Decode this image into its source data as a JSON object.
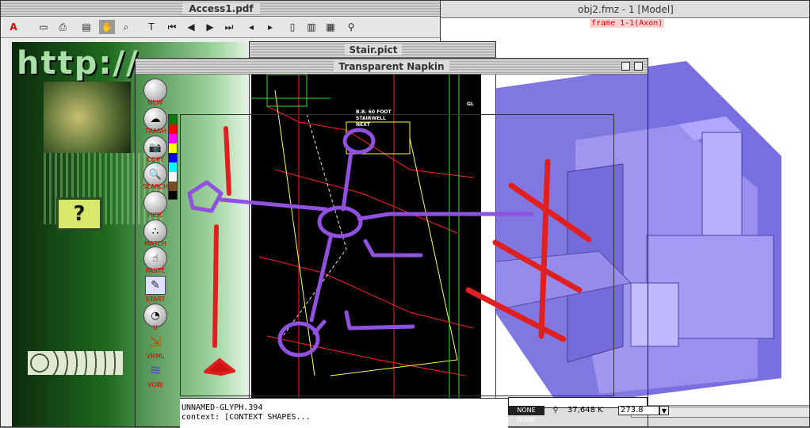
{
  "windows": {
    "pdf": {
      "title": "Access1.pdf",
      "banner": "http://"
    },
    "model": {
      "title": "obj2.fmz - 1 [Model]",
      "frame_label": "frame 1-1(Axon)"
    },
    "stair": {
      "title": "Stair.pict"
    },
    "napkin": {
      "title": "Transparent Napkin"
    }
  },
  "pdf_toolbar": {
    "icons": [
      "acrobat-icon",
      "open-icon",
      "print-icon",
      "page-icon",
      "hand-icon",
      "zoom-icon",
      "text-select-icon",
      "first-page-icon",
      "prev-page-icon",
      "next-page-icon",
      "last-page-icon",
      "go-back-icon",
      "go-forward-icon",
      "single-page-icon",
      "continuous-icon",
      "facing-icon",
      "find-icon"
    ]
  },
  "napkin_tools": [
    {
      "label": "NEW",
      "icon": "new-icon"
    },
    {
      "label": "TRASH",
      "icon": "trash-icon"
    },
    {
      "label": "COPY",
      "icon": "camera-icon"
    },
    {
      "label": "SEARCH",
      "icon": "search-icon"
    },
    {
      "label": "HIDE",
      "icon": "hide-icon"
    },
    {
      "label": "MATCH",
      "icon": "match-icon"
    },
    {
      "label": "PASTE",
      "icon": "paste-icon"
    },
    {
      "label": "START",
      "icon": "start-icon"
    },
    {
      "label": "U",
      "icon": "u-icon"
    },
    {
      "label": "VRML",
      "icon": "vrml-icon"
    },
    {
      "label": "VOBJ",
      "icon": "vobj-icon"
    }
  ],
  "palette": {
    "colors": [
      "#0a7a0a",
      "#ff0000",
      "#ff00ff",
      "#ffff00",
      "#0000ff",
      "#00ffff",
      "#ffffff",
      "#7a4a20",
      "#000000"
    ]
  },
  "status": {
    "line1": "UNNAMED-GLYPH.394",
    "line2": "context: [CONTEXT SHAPES...",
    "coord": "37,648 K",
    "zoom": "273.8",
    "mode_left": "NONE",
    "mode_right": "NONE"
  },
  "drawing_cad": {
    "label_a": "B.B. 60 FOOT",
    "label_b": "STAIRWELL",
    "label_c": "NEXT",
    "label_d": "GL"
  }
}
